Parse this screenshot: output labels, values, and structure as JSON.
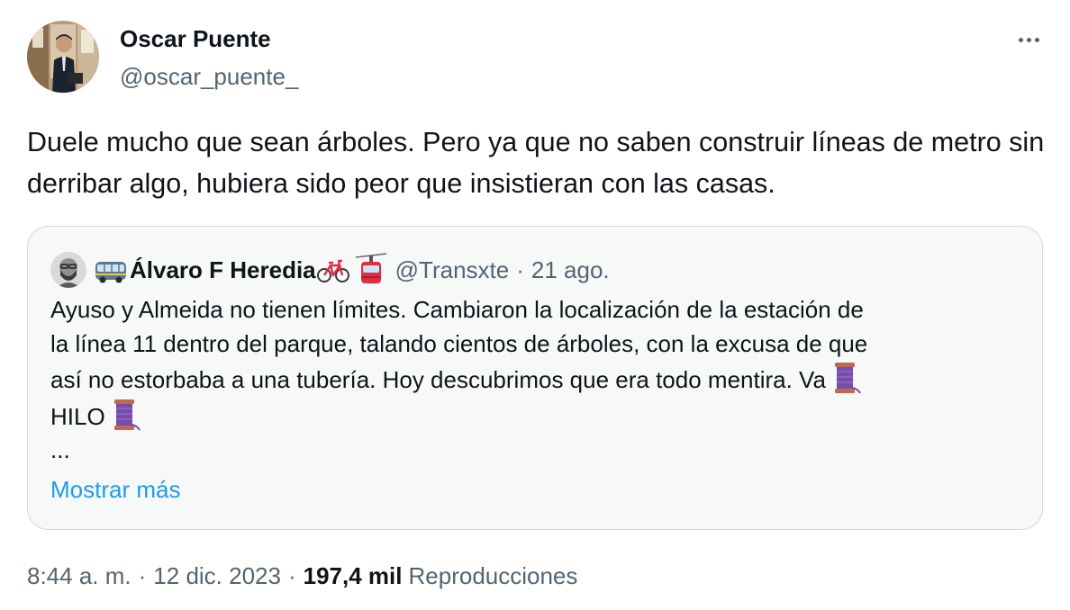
{
  "author": {
    "name": "Oscar Puente",
    "handle": "@oscar_puente_"
  },
  "tweet": {
    "text": "Duele mucho que sean árboles. Pero ya que no saben construir líneas de metro sin derribar algo, hubiera sido peor que insistieran con las casas."
  },
  "quoted": {
    "name": "Álvaro F Heredia",
    "name_prefix_icon": "bus-icon",
    "name_suffix_icons": [
      "bicycle-icon",
      "aerial-tramway-icon"
    ],
    "handle": "@Transxte",
    "separator": "·",
    "date": "21 ago.",
    "lines": [
      "Ayuso y Almeida no tienen límites. Cambiaron la localización de la estación de",
      "la línea 11 dentro del parque, talando cientos de árboles, con la excusa de que",
      "así no estorbaba a una tubería. Hoy descubrimos que era todo mentira. Va",
      "HILO",
      "..."
    ],
    "inline_icon": "thread-spool-icon",
    "show_more": "Mostrar más"
  },
  "meta": {
    "time": "8:44 a. m.",
    "sep1": "·",
    "date": "12 dic. 2023",
    "sep2": "·",
    "views_count": "197,4 mil",
    "views_label": "Reproducciones"
  },
  "colors": {
    "text": "#0f1419",
    "secondary": "#536471",
    "link": "#1d9bf0",
    "quote_border": "#cfd9de",
    "quote_bg": "#f7f9f9"
  }
}
